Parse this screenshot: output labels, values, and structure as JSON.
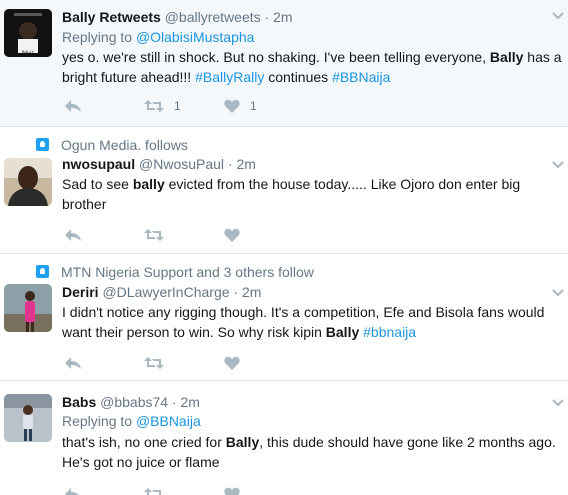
{
  "tweets": [
    {
      "author_name": "Bally Retweets",
      "handle": "@ballyretweets",
      "sep": "·",
      "time": "2m",
      "replying_prefix": "Replying to ",
      "replying_to": "@OlabisiMustapha",
      "text_a": "yes o. we're still in shock. But no shaking. I've been telling everyone, ",
      "text_bold": "Bally",
      "text_b": " has a bright future ahead!!! ",
      "tag1": "#BallyRally",
      "text_c": " continues ",
      "tag2": "#BBNaija",
      "retweets": "1",
      "likes": "1",
      "avatar_text": "BALLY"
    },
    {
      "context": "Ogun Media. follows",
      "author_name": "nwosupaul",
      "handle": "@NwosuPaul",
      "sep": "·",
      "time": "2m",
      "text_a": "Sad to see ",
      "text_bold": "bally",
      "text_b": " evicted from the house today..... Like Ojoro don enter big brother"
    },
    {
      "context": "MTN Nigeria Support and 3 others follow",
      "author_name": "Deriri",
      "handle": "@DLawyerInCharge",
      "sep": "·",
      "time": "2m",
      "text_a": "I didn't notice any rigging though. It's a competition, Efe and Bisola fans would want their person to win. So why risk kipin ",
      "text_bold": "Bally",
      "text_b": " ",
      "tag1": "#bbnaija"
    },
    {
      "author_name": "Babs",
      "handle": "@bbabs74",
      "sep": "·",
      "time": "2m",
      "replying_prefix": "Replying to ",
      "replying_to": "@BBNaija",
      "text_a": "that's ish, no one cried for ",
      "text_bold": "Bally",
      "text_b": ", this dude should have gone like 2 months ago. He's got no juice or flame"
    }
  ],
  "colors": {
    "link": "#1b95e0",
    "muted": "#657786",
    "icon": "#aab8c2",
    "badge": "#1da1f2"
  }
}
